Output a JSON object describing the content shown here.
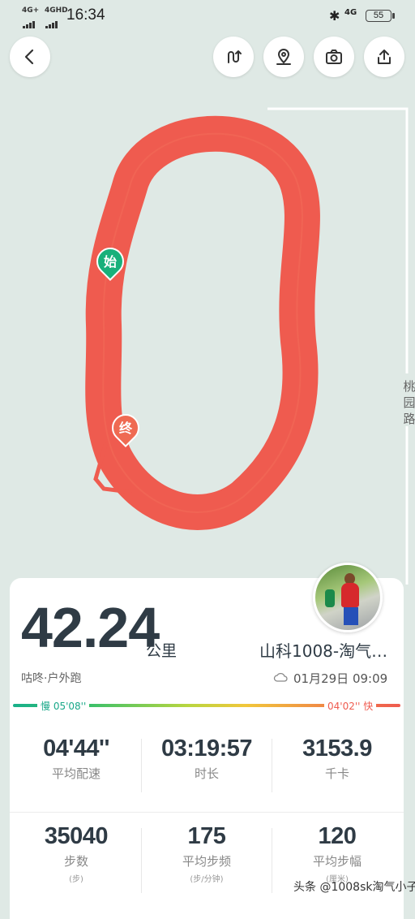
{
  "status_bar": {
    "network1": "4G+",
    "network2": "4GHD",
    "time": "16:34",
    "network3": "4G",
    "battery": "55"
  },
  "map": {
    "road_label": "桃园路",
    "start_marker": "始",
    "end_marker": "终",
    "route_color": "#ef5b4f"
  },
  "summary": {
    "distance": "42.24",
    "distance_unit": "公里",
    "username": "山科1008-淘气…",
    "sport_type": "咕咚·户外跑",
    "datetime": "01月29日 09:09",
    "pace_slow": "慢 05'08''",
    "pace_fast": "04'02'' 快"
  },
  "stats": {
    "row1": [
      {
        "value": "04'44''",
        "label": "平均配速"
      },
      {
        "value": "03:19:57",
        "label": "时长"
      },
      {
        "value": "3153.9",
        "label": "千卡"
      }
    ],
    "row2": [
      {
        "value": "35040",
        "label": "步数",
        "sub": "(步)"
      },
      {
        "value": "175",
        "label": "平均步频",
        "sub": "(步/分钟)"
      },
      {
        "value": "120",
        "label": "平均步幅",
        "sub": "(厘米)"
      }
    ]
  },
  "watermark": "头条 @1008sk淘气小子",
  "colors": {
    "accent_green": "#19b08a",
    "accent_red": "#ef5b4f",
    "text_dark": "#2f3b45"
  }
}
